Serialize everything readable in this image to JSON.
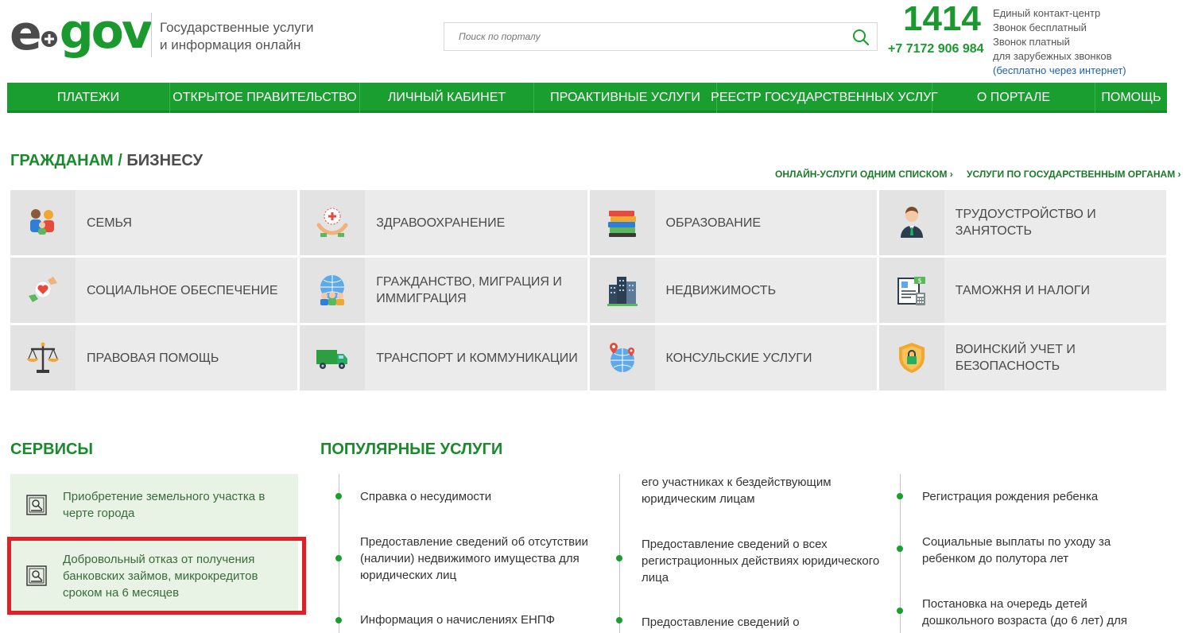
{
  "header": {
    "logo_e": "e",
    "logo_gov": "gov",
    "tagline_1": "Государственные услуги",
    "tagline_2": "и информация онлайн",
    "search_placeholder": "Поиск по порталу",
    "contact_number": "1414",
    "contact_phone": "+7 7172 906 984",
    "contact_line_1": "Единый контакт-центр",
    "contact_line_2": "Звонок бесплатный",
    "contact_line_3": "Звонок платный",
    "contact_line_4": "для зарубежных звонков",
    "contact_link": "(бесплатно через интернет)"
  },
  "nav": [
    "ПЛАТЕЖИ",
    "ОТКРЫТОЕ ПРАВИТЕЛЬСТВО",
    "ЛИЧНЫЙ КАБИНЕТ",
    "ПРОАКТИВНЫЕ УСЛУГИ",
    "РЕЕСТР ГОСУДАРСТВЕННЫХ УСЛУГ",
    "О ПОРТАЛЕ",
    "ПОМОЩЬ"
  ],
  "section": {
    "citizens": "ГРАЖДАНАМ",
    "separator": " / ",
    "business": "БИЗНЕСУ",
    "link_list": "ОНЛАЙН-УСЛУГИ ОДНИМ СПИСКОМ ›",
    "link_agencies": "УСЛУГИ ПО ГОСУДАРСТВЕННЫМ ОРГАНАМ ›"
  },
  "categories": [
    {
      "label": "СЕМЬЯ",
      "icon": "family-icon"
    },
    {
      "label": "ЗДРАВООХРАНЕНИЕ",
      "icon": "healthcare-icon"
    },
    {
      "label": "ОБРАЗОВАНИЕ",
      "icon": "books-icon"
    },
    {
      "label": "ТРУДОУСТРОЙСТВО И ЗАНЯТОСТЬ",
      "icon": "worker-icon"
    },
    {
      "label": "СОЦИАЛЬНОЕ ОБЕСПЕЧЕНИЕ",
      "icon": "heart-hands-icon"
    },
    {
      "label": "ГРАЖДАНСТВО, МИГРАЦИЯ И ИММИГРАЦИЯ",
      "icon": "globe-people-icon"
    },
    {
      "label": "НЕДВИЖИМОСТЬ",
      "icon": "buildings-icon"
    },
    {
      "label": "ТАМОЖНЯ И НАЛОГИ",
      "icon": "tax-document-icon"
    },
    {
      "label": "ПРАВОВАЯ ПОМОЩЬ",
      "icon": "scales-icon"
    },
    {
      "label": "ТРАНСПОРТ И КОММУНИКАЦИИ",
      "icon": "truck-icon"
    },
    {
      "label": "КОНСУЛЬСКИЕ УСЛУГИ",
      "icon": "globe-pins-icon"
    },
    {
      "label": "ВОИНСКИЙ УЧЕТ И БЕЗОПАСНОСТЬ",
      "icon": "shield-lock-icon"
    }
  ],
  "services": {
    "title": "СЕРВИСЫ",
    "items": [
      "Приобретение земельного участка в черте города",
      "Добровольный отказ от получения банковских займов, микрокредитов сроком на 6 месяцев"
    ]
  },
  "popular": {
    "title": "ПОПУЛЯРНЫЕ УСЛУГИ",
    "col1": [
      "Справка о несудимости",
      "Предоставление сведений об отсутствии (наличии) недвижимого имущества для юридических лиц",
      "Информация о начислениях ЕНПФ"
    ],
    "col2": [
      "его участниках к бездействующим юридическим лицам",
      "Предоставление сведений о всех регистрационных действиях юридического лица",
      "Предоставление сведений о"
    ],
    "col3": [
      "Регистрация рождения ребенка",
      "Социальные выплаты по уходу за ребенком до полутора лет",
      "Постановка на очередь детей дошкольного возраста (до 6 лет) для"
    ]
  },
  "colors": {
    "brand_green": "#1b9e30",
    "highlight_red": "#e31e24"
  }
}
